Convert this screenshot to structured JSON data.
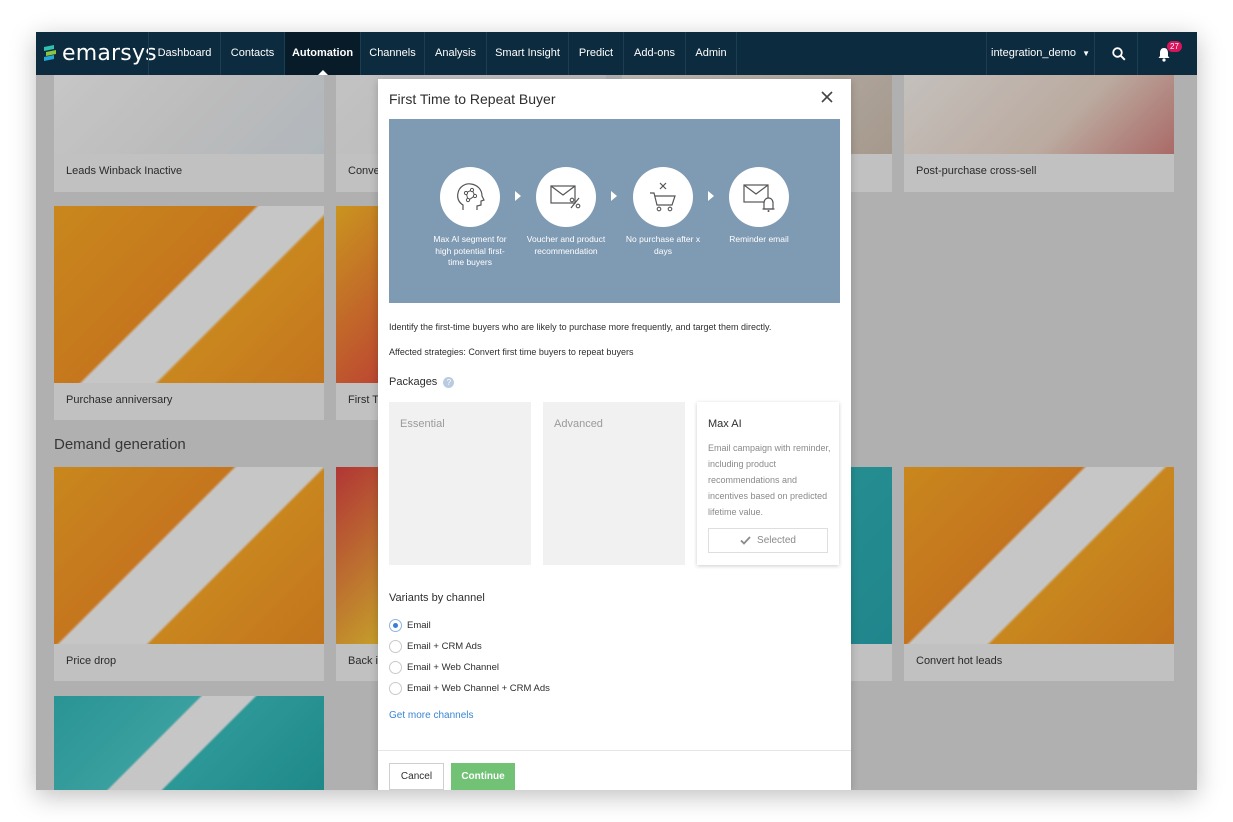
{
  "brand": {
    "name": "emarsys"
  },
  "nav": {
    "items": [
      {
        "label": "Dashboard"
      },
      {
        "label": "Contacts"
      },
      {
        "label": "Automation"
      },
      {
        "label": "Channels"
      },
      {
        "label": "Analysis"
      },
      {
        "label": "Smart Insight"
      },
      {
        "label": "Predict"
      },
      {
        "label": "Add-ons"
      },
      {
        "label": "Admin"
      }
    ],
    "active": "Automation",
    "user": "integration_demo",
    "notification_count": "27"
  },
  "background": {
    "cards": [
      {
        "title": "Leads Winback Inactive"
      },
      {
        "title": "Conve"
      },
      {
        "title": "Post-purchase cross-sell"
      },
      {
        "title": "Purchase anniversary"
      },
      {
        "title": "First T"
      },
      {
        "title": "Price drop"
      },
      {
        "title": "Back i"
      },
      {
        "title": "Convert hot leads"
      }
    ],
    "section_heading": "Demand generation"
  },
  "modal": {
    "title": "First Time to Repeat Buyer",
    "steps": [
      {
        "icon": "ai-head-icon",
        "label": "Max AI segment for high potential first-time buyers"
      },
      {
        "icon": "voucher-envelope-icon",
        "label": "Voucher and product recommendation"
      },
      {
        "icon": "cart-no-purchase-icon",
        "label": "No purchase after x days"
      },
      {
        "icon": "reminder-email-icon",
        "label": "Reminder email"
      }
    ],
    "description": "Identify the first-time buyers who are likely to purchase more frequently, and target them directly.",
    "affected_strategies": "Affected strategies: Convert first time buyers to repeat buyers",
    "packages_label": "Packages",
    "packages": [
      {
        "name": "Essential",
        "description": "",
        "selected": false
      },
      {
        "name": "Advanced",
        "description": "",
        "selected": false
      },
      {
        "name": "Max AI",
        "description": "Email campaign with reminder, including product recommendations and incentives based on predicted lifetime value.",
        "selected": true,
        "selected_label": "Selected"
      }
    ],
    "variants_label": "Variants by channel",
    "variants": [
      {
        "label": "Email",
        "checked": true
      },
      {
        "label": "Email + CRM Ads",
        "checked": false
      },
      {
        "label": "Email + Web Channel",
        "checked": false
      },
      {
        "label": "Email + Web Channel + CRM Ads",
        "checked": false
      }
    ],
    "more_channels_link": "Get more channels",
    "cancel_label": "Cancel",
    "continue_label": "Continue"
  },
  "colors": {
    "nav_bg": "#0d2b3e",
    "banner_bg": "#7f9ab3",
    "continue_bg": "#72c276",
    "link": "#3a85d2",
    "badge": "#d8145b"
  }
}
